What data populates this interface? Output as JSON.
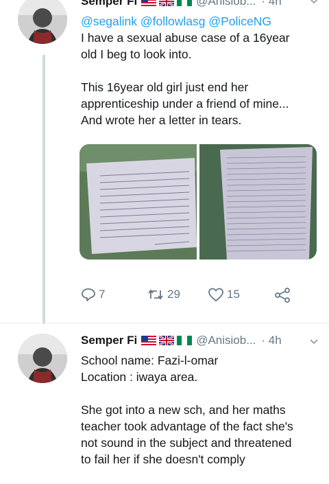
{
  "tweets": [
    {
      "name": "Semper Fi",
      "handle": "@Anisiob...",
      "time": "· 4h",
      "mentions": "@segalink @followlasg @PoliceNG",
      "lines": [
        "I have a sexual abuse case of a 16year",
        "old  I beg to look into.",
        "",
        "This 16year old girl just end her",
        "apprenticeship under a friend of mine...",
        "And wrote her a letter in tears."
      ],
      "actions": {
        "replies": "7",
        "retweets": "29",
        "likes": "15"
      },
      "media": [
        "letter-photo-1",
        "letter-photo-2"
      ]
    },
    {
      "name": "Semper Fi",
      "handle": "@Anisiob...",
      "time": "· 4h",
      "lines": [
        "School name: Fazi-l-omar",
        "Location : iwaya area.",
        "",
        "She got into a new sch, and her maths",
        "teacher took advantage of the fact she's",
        "not sound in the subject and threatened",
        "to fail her if she doesn't comply"
      ]
    }
  ],
  "colors": {
    "link": "#1da1f2",
    "secondary": "#657786",
    "text": "#14171a"
  }
}
